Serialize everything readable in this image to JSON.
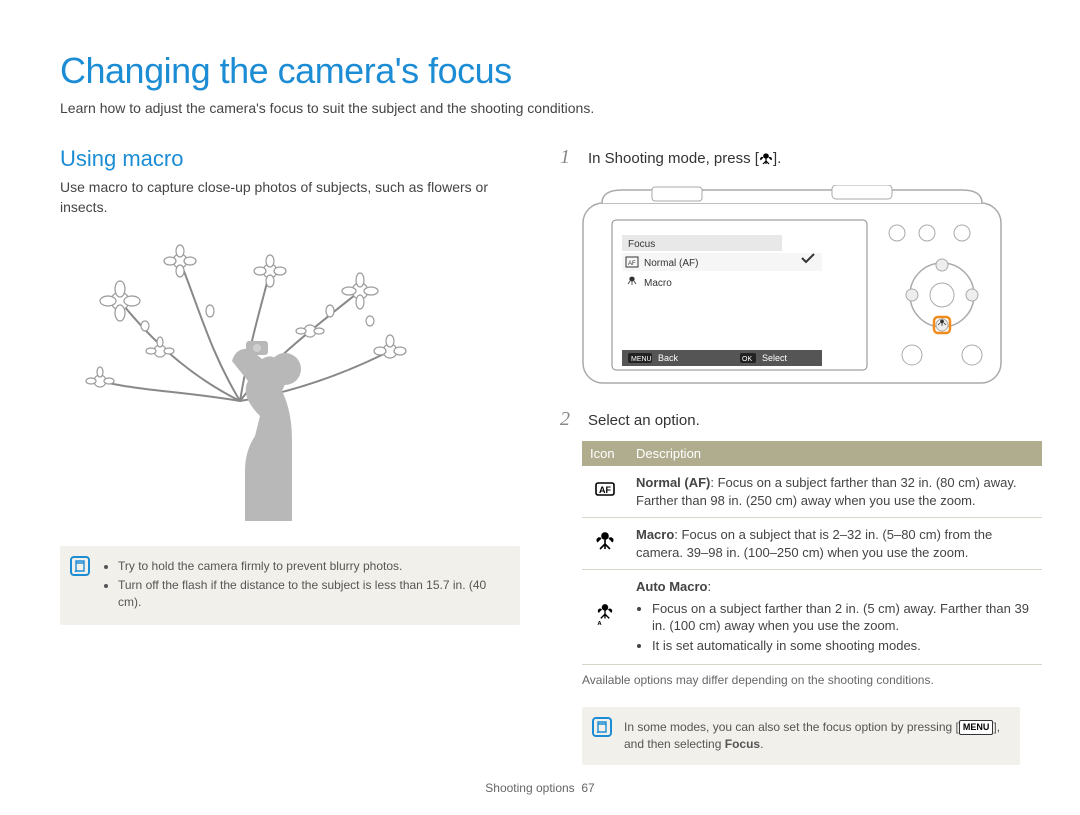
{
  "pageTitle": "Changing the camera's focus",
  "intro": "Learn how to adjust the camera's focus to suit the subject and the shooting conditions.",
  "left": {
    "heading": "Using macro",
    "para": "Use macro to capture close-up photos of subjects, such as flowers or insects.",
    "notes": [
      "Try to hold the camera firmly to prevent blurry photos.",
      "Turn off the flash if the distance to the subject is less than 15.7 in. (40 cm)."
    ]
  },
  "right": {
    "step1_pre": "In Shooting mode, press [",
    "step1_post": "].",
    "step2": "Select an option.",
    "camera_screen": {
      "title": "Focus",
      "opt1": "Normal (AF)",
      "opt2": "Macro",
      "back_btn": "MENU",
      "back_label": "Back",
      "select_btn": "OK",
      "select_label": "Select"
    },
    "table": {
      "hdr_icon": "Icon",
      "hdr_desc": "Description",
      "r1_title": "Normal (AF)",
      "r1_body": ": Focus on a subject farther than 32 in. (80 cm) away. Farther than 98 in. (250 cm) away when you use the zoom.",
      "r2_title": "Macro",
      "r2_body": ": Focus on a subject that is 2–32 in. (5–80 cm) from the camera. 39–98 in. (100–250 cm) when you use the zoom.",
      "r3_title": "Auto Macro",
      "r3_colon": ":",
      "r3_b1": "Focus on a subject farther than 2 in. (5 cm) away. Farther than 39 in. (100 cm) away when you use the zoom.",
      "r3_b2": "It is set automatically in some shooting modes."
    },
    "avail": "Available options may differ depending on the shooting conditions.",
    "note2_pre": "In some modes, you can also set the focus option by pressing [",
    "note2_menu": "MENU",
    "note2_mid": "], and then selecting ",
    "note2_focus": "Focus",
    "note2_post": "."
  },
  "footer": {
    "section": "Shooting options",
    "page": "67"
  }
}
